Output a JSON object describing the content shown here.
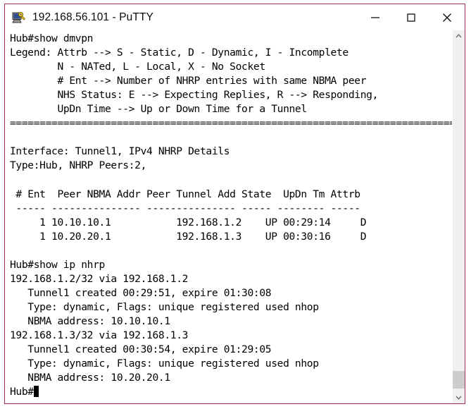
{
  "window": {
    "title": "192.168.56.101 - PuTTY",
    "icon": "putty-icon",
    "border_color": "#a4354a",
    "titlebar_bg": "#ffffff",
    "title_color": "#0b0b0b"
  },
  "controls": {
    "minimize_label": "Minimize",
    "maximize_label": "Maximize",
    "close_label": "Close"
  },
  "terminal": {
    "background": "#ffffff",
    "foreground": "#000000",
    "cursor": "block",
    "lines": [
      "Hub#show dmvpn",
      "Legend: Attrb --> S - Static, D - Dynamic, I - Incomplete",
      "        N - NATed, L - Local, X - No Socket",
      "        # Ent --> Number of NHRP entries with same NBMA peer",
      "        NHS Status: E --> Expecting Replies, R --> Responding,",
      "        UpDn Time --> Up or Down Time for a Tunnel",
      "==============================================================================",
      "",
      "Interface: Tunnel1, IPv4 NHRP Details",
      "Type:Hub, NHRP Peers:2,",
      "",
      " # Ent  Peer NBMA Addr Peer Tunnel Add State  UpDn Tm Attrb",
      " ----- --------------- --------------- ----- -------- -----",
      "     1 10.10.10.1           192.168.1.2    UP 00:29:14     D",
      "     1 10.20.20.1           192.168.1.3    UP 00:30:16     D",
      "",
      "Hub#show ip nhrp",
      "192.168.1.2/32 via 192.168.1.2",
      "   Tunnel1 created 00:29:51, expire 01:30:08",
      "   Type: dynamic, Flags: unique registered used nhop",
      "   NBMA address: 10.10.10.1",
      "192.168.1.3/32 via 192.168.1.3",
      "   Tunnel1 created 00:30:54, expire 01:29:05",
      "   Type: dynamic, Flags: unique registered used nhop",
      "   NBMA address: 10.20.20.1"
    ],
    "prompt": "Hub#",
    "dmvpn_table": {
      "headers": [
        "# Ent",
        "Peer NBMA Addr",
        "Peer Tunnel Add",
        "State",
        "UpDn Tm",
        "Attrb"
      ],
      "rows": [
        [
          "1",
          "10.10.10.1",
          "192.168.1.2",
          "UP",
          "00:29:14",
          "D"
        ],
        [
          "1",
          "10.20.20.1",
          "192.168.1.3",
          "UP",
          "00:30:16",
          "D"
        ]
      ]
    }
  },
  "scrollbar": {
    "up_arrow": "chevron-up-icon",
    "down_arrow": "chevron-down-icon",
    "thumb": "scrollbar-thumb",
    "thumb_color": "#cdcdcd",
    "track_color": "#f0f0f0"
  }
}
